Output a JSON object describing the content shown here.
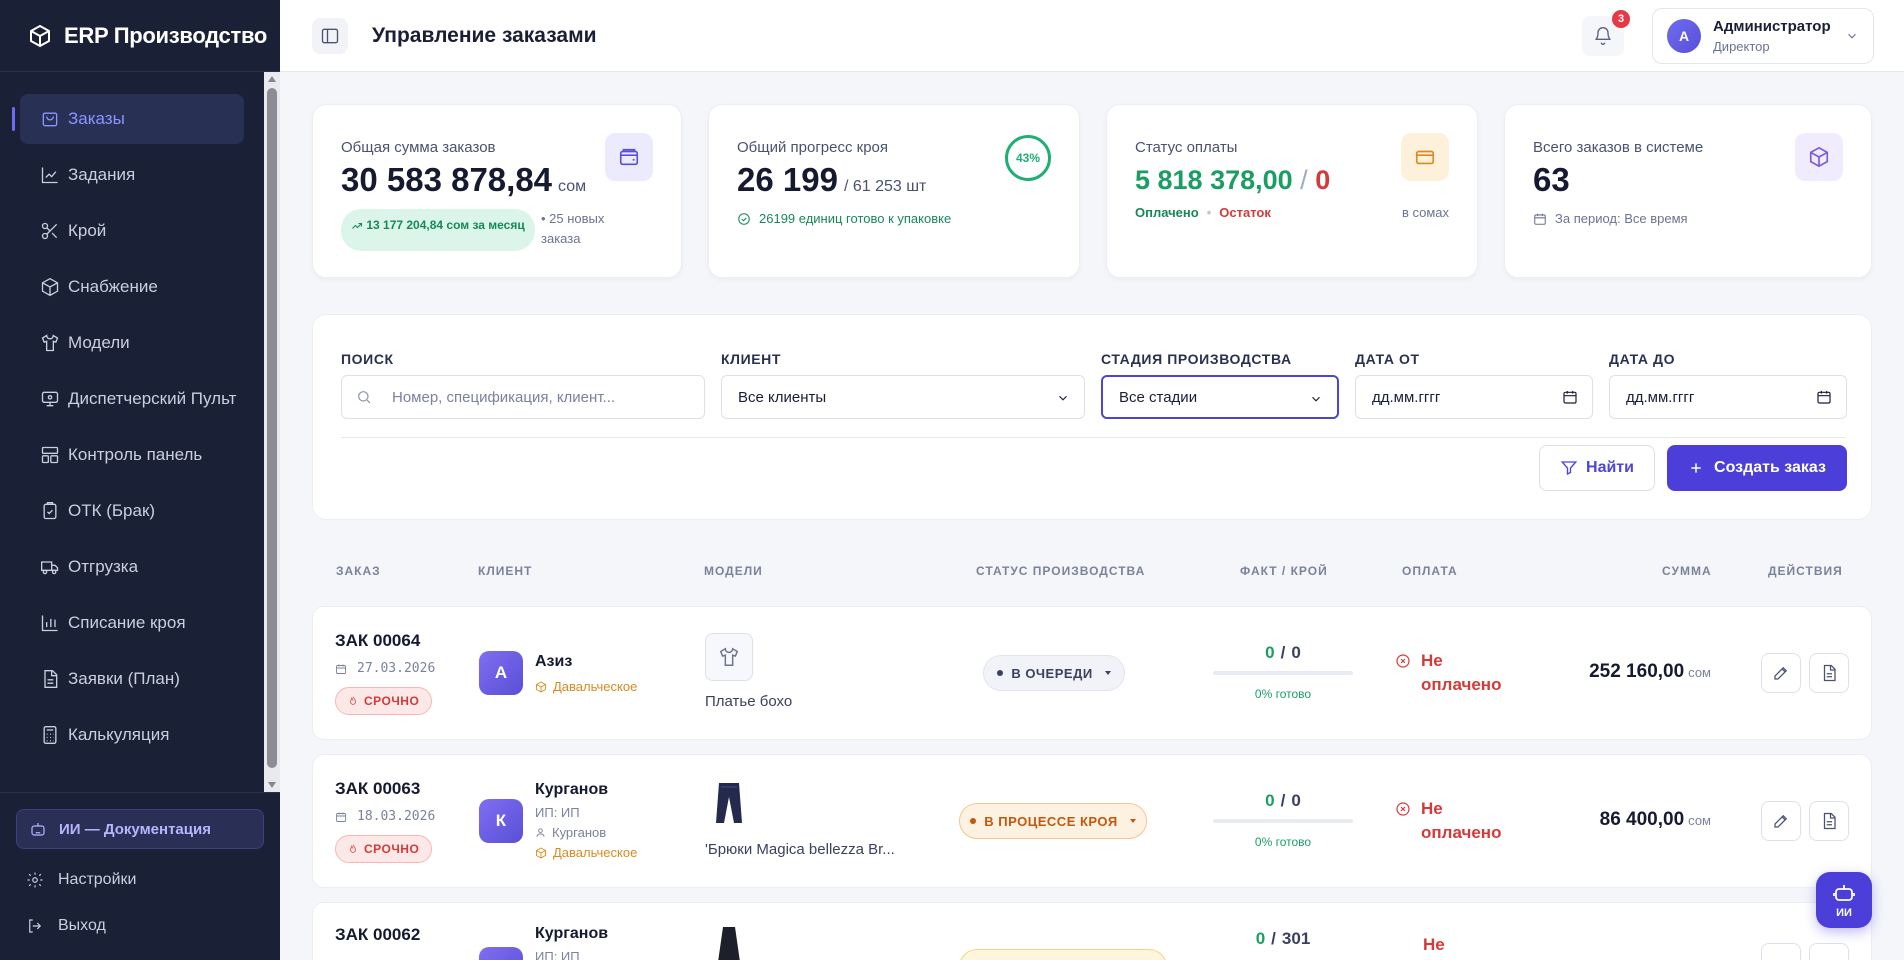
{
  "app": {
    "brand": "ERP Производство"
  },
  "sidebar": {
    "items": [
      {
        "label": "Заказы",
        "icon": "cart-icon",
        "active": true
      },
      {
        "label": "Задания",
        "icon": "chart-icon"
      },
      {
        "label": "Крой",
        "icon": "scissors-icon"
      },
      {
        "label": "Снабжение",
        "icon": "box-icon"
      },
      {
        "label": "Модели",
        "icon": "shirt-icon"
      },
      {
        "label": "Диспетчерский Пульт",
        "icon": "monitor-icon"
      },
      {
        "label": "Контроль панель",
        "icon": "layout-icon"
      },
      {
        "label": "ОТК (Брак)",
        "icon": "clipboard-check-icon"
      },
      {
        "label": "Отгрузка",
        "icon": "truck-icon"
      },
      {
        "label": "Списание кроя",
        "icon": "bar-chart-icon"
      },
      {
        "label": "Заявки (План)",
        "icon": "file-text-icon"
      },
      {
        "label": "Калькуляция",
        "icon": "calculator-icon"
      }
    ],
    "ai_doc": "ИИ — Документация",
    "settings": "Настройки",
    "logout": "Выход"
  },
  "header": {
    "title": "Управление заказами",
    "notifications": "3",
    "user_initial": "А",
    "user_name": "Администратор",
    "user_role": "Директор"
  },
  "stats": {
    "total": {
      "label": "Общая сумма заказов",
      "value": "30 583 878,84",
      "unit": "сом",
      "trend": "13 177 204,84 сом за месяц",
      "new_orders": "• 25 новых заказа"
    },
    "cutting": {
      "label": "Общий прогресс кроя",
      "value": "26 199",
      "total": "/ 61 253 шт",
      "percent": "43%",
      "progress": 0.43,
      "note": "26199 единиц готово к упаковке"
    },
    "payment": {
      "label": "Статус оплаты",
      "paid": "5 818 378,00",
      "sep": "/",
      "rest": "0",
      "paid_label": "Оплачено",
      "dot": "•",
      "rest_label": "Остаток",
      "unit_note": "в сомах"
    },
    "orders": {
      "label": "Всего заказов в системе",
      "value": "63",
      "period": "За период: Все время"
    }
  },
  "filters": {
    "search_label": "ПОИСК",
    "search_placeholder": "Номер, спецификация, клиент...",
    "client_label": "КЛИЕНТ",
    "client_value": "Все клиенты",
    "stage_label": "СТАДИЯ ПРОИЗВОДСТВА",
    "stage_value": "Все стадии",
    "date_from_label": "ДАТА ОТ",
    "date_from_value": "дд.мм.гггг",
    "date_to_label": "ДАТА ДО",
    "date_to_value": "дд.мм.гггг",
    "find_button": "Найти",
    "create_button": "Создать заказ"
  },
  "table": {
    "headers": {
      "order": "ЗАКАЗ",
      "client": "КЛИЕНТ",
      "models": "МОДЕЛИ",
      "status": "СТАТУС ПРОИЗВОДСТВА",
      "fact": "ФАКТ / КРОЙ",
      "payment": "ОПЛАТА",
      "sum": "СУММА",
      "actions": "ДЕЙСТВИЯ"
    },
    "rows": [
      {
        "number": "ЗАК 00064",
        "date": "27.03.2026",
        "urgent": "СРОЧНО",
        "client_initial": "А",
        "client": "Азиз",
        "client_type": "Давальческое",
        "model": "Платье бохо",
        "status": "В ОЧЕРЕДИ",
        "fact": "0",
        "sep": "/",
        "cut": "0",
        "percent": "0% готово",
        "payment_line1": "Не",
        "payment_line2": "оплачено",
        "amount": "252 160,00",
        "currency": "сом"
      },
      {
        "number": "ЗАК 00063",
        "date": "18.03.2026",
        "urgent": "СРОЧНО",
        "client_initial": "К",
        "client": "Курганов",
        "client_sub1": "ИП: ИП",
        "client_sub2": "Курганов",
        "client_type": "Давальческое",
        "model": "'Брюки Magica bellezza Br...",
        "status": "В ПРОЦЕССЕ КРОЯ",
        "fact": "0",
        "sep": "/",
        "cut": "0",
        "percent": "0% готово",
        "payment_line1": "Не",
        "payment_line2": "оплачено",
        "amount": "86 400,00",
        "currency": "сом"
      },
      {
        "number": "ЗАК 00062",
        "client": "Курганов",
        "client_sub1": "ИП: ИП",
        "fact": "0",
        "sep": "/",
        "cut": "301",
        "payment_line1": "Не"
      }
    ]
  },
  "ai_fab": "ИИ",
  "colors": {
    "accent": "#4c3ed8",
    "sidebar": "#1a2035",
    "success": "#1b9e64",
    "danger": "#d33a3a",
    "warning": "#d98b1c"
  }
}
